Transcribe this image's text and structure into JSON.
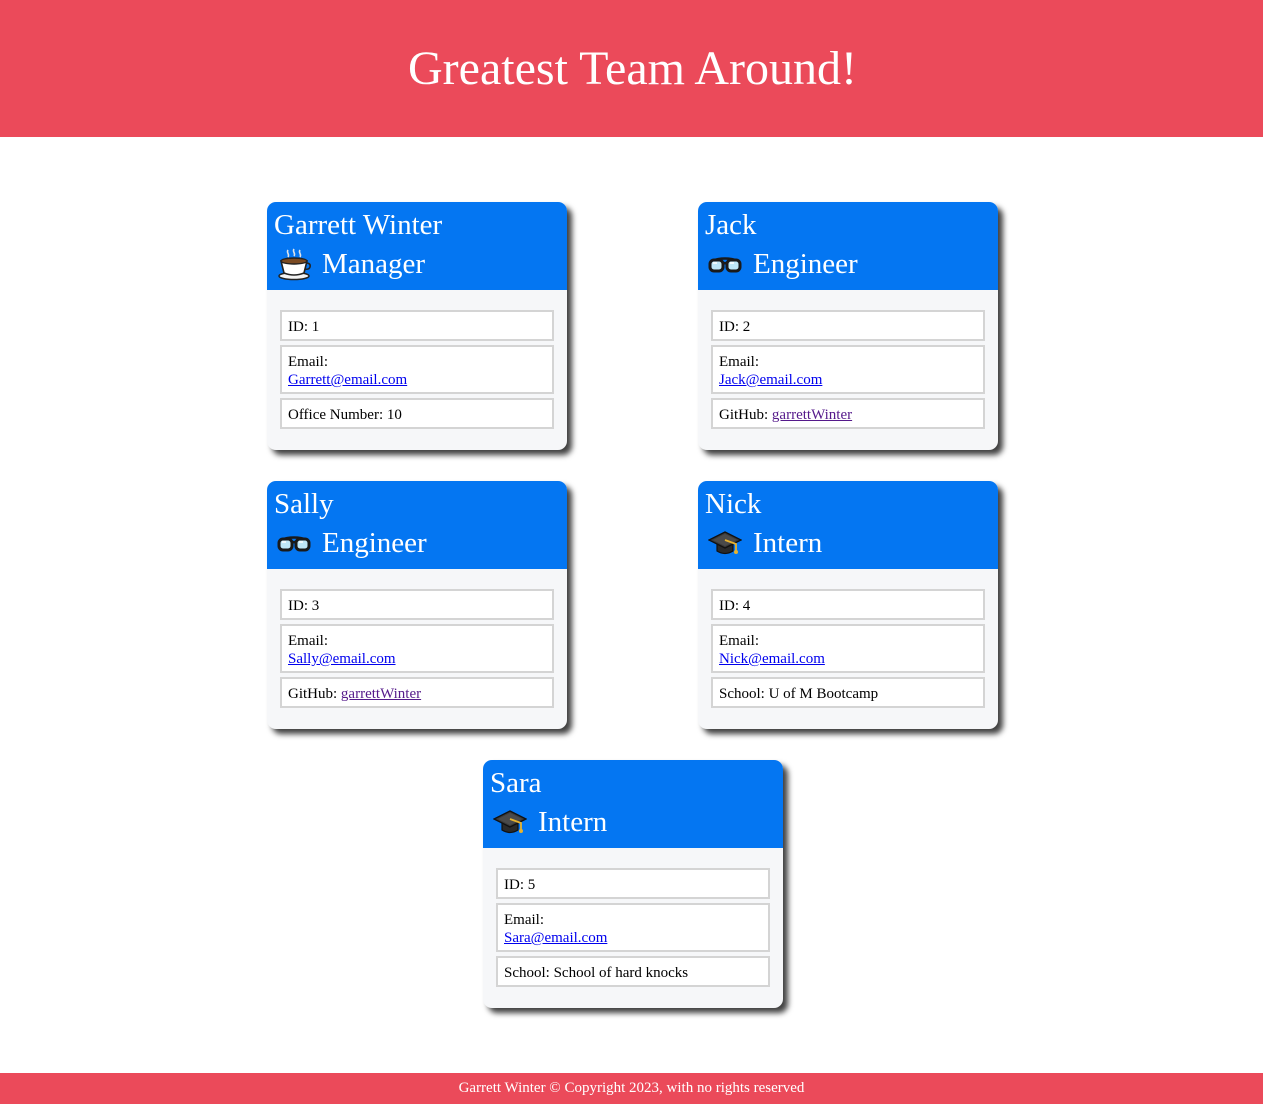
{
  "header": {
    "title": "Greatest Team Around!"
  },
  "cards": [
    {
      "name": "Garrett Winter",
      "role": "Manager",
      "icon": "coffee-icon",
      "id_text": "ID: 1",
      "email_label": "Email:",
      "email": "Garrett@email.com",
      "extra_prefix": "Office Number: 10",
      "extra_link": ""
    },
    {
      "name": "Jack",
      "role": "Engineer",
      "icon": "glasses-icon",
      "id_text": "ID: 2",
      "email_label": "Email:",
      "email": "Jack@email.com",
      "extra_prefix": "GitHub: ",
      "extra_link": "garrettWinter"
    },
    {
      "name": "Sally",
      "role": "Engineer",
      "icon": "glasses-icon",
      "id_text": "ID: 3",
      "email_label": "Email:",
      "email": "Sally@email.com",
      "extra_prefix": "GitHub: ",
      "extra_link": "garrettWinter"
    },
    {
      "name": "Nick",
      "role": "Intern",
      "icon": "graduation-cap-icon",
      "id_text": "ID: 4",
      "email_label": "Email:",
      "email": "Nick@email.com",
      "extra_prefix": "School: U of M Bootcamp",
      "extra_link": ""
    },
    {
      "name": "Sara",
      "role": "Intern",
      "icon": "graduation-cap-icon",
      "id_text": "ID: 5",
      "email_label": "Email:",
      "email": "Sara@email.com",
      "extra_prefix": "School: School of hard knocks",
      "extra_link": ""
    }
  ],
  "footer": {
    "text": "Garrett Winter © Copyright 2023, with no rights reserved"
  },
  "colors": {
    "header_bg": "#eb4a5a",
    "card_head": "#0476f2",
    "link": "#0000ee",
    "visited_link": "#551a8b"
  }
}
